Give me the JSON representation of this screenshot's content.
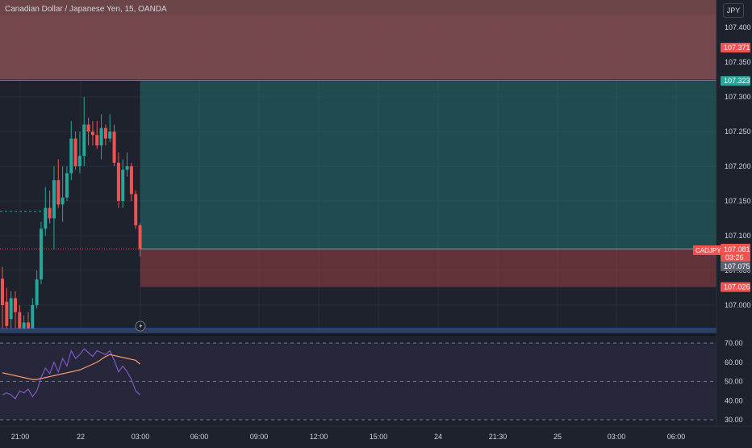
{
  "header": {
    "symbol_title": "Canadian Dollar / Japanese Yen, 15, OANDA",
    "currency_button": "JPY"
  },
  "colors": {
    "background": "#1e222d",
    "up_candle": "#26a69a",
    "down_candle": "#ef5350",
    "target_zone": "#26a69a",
    "stop_zone": "#ef5350",
    "rsi_line": "#7e57c2",
    "rsi_ma_line": "#ff9a6b"
  },
  "price_axis": {
    "ticks": [
      "107.400",
      "107.350",
      "107.300",
      "107.250",
      "107.200",
      "107.150",
      "107.100",
      "107.050",
      "107.000"
    ],
    "badges": {
      "upper_zone": "107.371",
      "target": "107.323",
      "last_price": "107.081",
      "countdown": "03:26",
      "entry": "107.075",
      "stop": "107.026",
      "symbol": "CADJPY"
    }
  },
  "rsi_axis": {
    "ticks": [
      "70.00",
      "60.00",
      "50.00",
      "40.00",
      "30.00"
    ]
  },
  "time_axis": {
    "ticks": [
      "21:00",
      "22",
      "03:00",
      "06:00",
      "09:00",
      "12:00",
      "15:00",
      "24",
      "21:30",
      "25",
      "03:00",
      "06:00"
    ]
  },
  "chart_data": {
    "type": "candlestick",
    "x_time_labels": [
      "21:00",
      "22",
      "03:00",
      "06:00",
      "09:00",
      "12:00",
      "15:00",
      "24",
      "21:30",
      "25",
      "03:00",
      "06:00"
    ],
    "ylim": [
      106.955,
      107.455
    ],
    "upper_zone": [
      107.325,
      107.455
    ],
    "position_zones": {
      "target": 107.323,
      "entry": 107.081,
      "stop": 107.026
    },
    "candles": [
      {
        "o": 107.038,
        "h": 107.055,
        "c": 107.0,
        "l": 106.955
      },
      {
        "o": 107.005,
        "h": 107.025,
        "c": 106.97,
        "l": 106.955
      },
      {
        "o": 106.98,
        "h": 107.02,
        "c": 107.01,
        "l": 106.955
      },
      {
        "o": 107.01,
        "h": 107.02,
        "c": 106.99,
        "l": 106.955
      },
      {
        "o": 106.99,
        "h": 107.0,
        "c": 106.965,
        "l": 106.955
      },
      {
        "o": 106.965,
        "h": 106.985,
        "c": 106.975,
        "l": 106.955
      },
      {
        "o": 106.975,
        "h": 106.99,
        "c": 106.96,
        "l": 106.955
      },
      {
        "o": 106.96,
        "h": 107.01,
        "c": 107.0,
        "l": 106.955
      },
      {
        "o": 107.0,
        "h": 107.05,
        "c": 107.037,
        "l": 106.995
      },
      {
        "o": 107.037,
        "h": 107.12,
        "c": 107.11,
        "l": 107.03
      },
      {
        "o": 107.11,
        "h": 107.17,
        "c": 107.14,
        "l": 107.1
      },
      {
        "o": 107.14,
        "h": 107.165,
        "c": 107.125,
        "l": 107.118
      },
      {
        "o": 107.125,
        "h": 107.2,
        "c": 107.18,
        "l": 107.08
      },
      {
        "o": 107.18,
        "h": 107.21,
        "c": 107.145,
        "l": 107.14
      },
      {
        "o": 107.145,
        "h": 107.2,
        "c": 107.155,
        "l": 107.12
      },
      {
        "o": 107.155,
        "h": 107.2,
        "c": 107.19,
        "l": 107.15
      },
      {
        "o": 107.19,
        "h": 107.265,
        "c": 107.24,
        "l": 107.18
      },
      {
        "o": 107.24,
        "h": 107.25,
        "c": 107.2,
        "l": 107.195
      },
      {
        "o": 107.2,
        "h": 107.25,
        "c": 107.215,
        "l": 107.19
      },
      {
        "o": 107.215,
        "h": 107.3,
        "c": 107.26,
        "l": 107.2
      },
      {
        "o": 107.26,
        "h": 107.27,
        "c": 107.25,
        "l": 107.23
      },
      {
        "o": 107.25,
        "h": 107.265,
        "c": 107.245,
        "l": 107.23
      },
      {
        "o": 107.245,
        "h": 107.265,
        "c": 107.23,
        "l": 107.225
      },
      {
        "o": 107.23,
        "h": 107.275,
        "c": 107.255,
        "l": 107.21
      },
      {
        "o": 107.255,
        "h": 107.26,
        "c": 107.24,
        "l": 107.23
      },
      {
        "o": 107.24,
        "h": 107.275,
        "c": 107.25,
        "l": 107.235
      },
      {
        "o": 107.25,
        "h": 107.26,
        "c": 107.205,
        "l": 107.2
      },
      {
        "o": 107.205,
        "h": 107.22,
        "c": 107.15,
        "l": 107.14
      },
      {
        "o": 107.15,
        "h": 107.21,
        "c": 107.195,
        "l": 107.14
      },
      {
        "o": 107.195,
        "h": 107.22,
        "c": 107.2,
        "l": 107.185
      },
      {
        "o": 107.2,
        "h": 107.205,
        "c": 107.16,
        "l": 107.15
      },
      {
        "o": 107.16,
        "h": 107.165,
        "c": 107.115,
        "l": 107.11
      },
      {
        "o": 107.115,
        "h": 107.118,
        "c": 107.081,
        "l": 107.07
      }
    ],
    "rsi": [
      43,
      44,
      43,
      41,
      45,
      44,
      46,
      42,
      45,
      52,
      57,
      54,
      60,
      55,
      62,
      58,
      66,
      62,
      64,
      67,
      65,
      63,
      66,
      65,
      64,
      66,
      61,
      55,
      58,
      55,
      51,
      45,
      43
    ],
    "rsi_ma": [
      54.5,
      54,
      53.5,
      53,
      52.5,
      52,
      51.5,
      51,
      51,
      51.5,
      52,
      52.5,
      53,
      53.5,
      54,
      54.5,
      55,
      55.5,
      56,
      57,
      58,
      59,
      60,
      61.5,
      63,
      64,
      63.5,
      63,
      62.5,
      62,
      61.5,
      61,
      59
    ],
    "rsi_ylim": [
      26,
      73
    ]
  }
}
